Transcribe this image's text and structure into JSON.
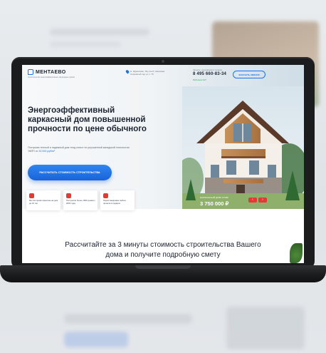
{
  "site": {
    "logo_text": "МЕНТАЕВО",
    "tagline": "строительство энергоэффективных загородных домов",
    "address": "м. Щукинская, Ясу-Ан 8, Николаев Сорокатый пер ул.п. 76",
    "phone_note": "Звоните, перезвоним в течение",
    "phone": "8 495 660-83-34",
    "online_status": "Работаем 24/7",
    "callback_label": "ЗАКАЗАТЬ ЗВОНОК"
  },
  "hero": {
    "headline": "Энергоэффективный каркасный дом повышенной прочности по цене обычного",
    "lead_text": "Построим теплый и надежный дом «под ключ» по улучшенной канадской технологии ЭКПП от ",
    "lead_price": "33 000 руб/м²",
    "cta_label": "РАССЧИТАТЬ СТОИМОСТЬ СТРОИТЕЛЬСТВА"
  },
  "features": [
    {
      "icon": "shield-icon",
      "text": "Мы построим гарантию на дом до 10 лет"
    },
    {
      "icon": "house-icon",
      "text": "Построили более 1600 домов с 2002 года"
    },
    {
      "icon": "document-icon",
      "text": "Перепланировка любого проекта в подарок"
    }
  ],
  "price_card": {
    "label": "КАРКАСНЫЙ ДОМ 1ТЭМ",
    "value": "3 750 000 ₽",
    "prev_arrow": "‹",
    "next_arrow": "›"
  },
  "section2": {
    "title": "Рассчитайте за 3 минуты стоимость строительства Вашего дома и получите подробную смету"
  },
  "colors": {
    "accent": "#1a73e8",
    "red": "#e53935",
    "text": "#1c2430"
  }
}
